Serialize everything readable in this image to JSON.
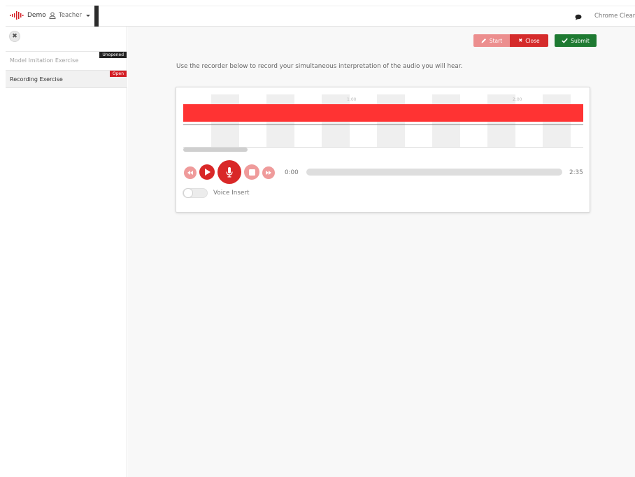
{
  "navbar": {
    "brand_label": "Demo",
    "user_label": "Teacher",
    "browser_label": "Chrome Clean"
  },
  "sidebar": {
    "exercises": [
      {
        "label": "Model Imitation Exercise",
        "badge": "Unopened"
      },
      {
        "label": "Recording Exercise",
        "badge": "Open"
      }
    ]
  },
  "toolbar": {
    "start_label": "Start",
    "close_label": "Close",
    "submit_label": "Submit"
  },
  "main": {
    "instruction": "Use the recorder below to record your simultaneous interpretation of the audio you will hear."
  },
  "recorder": {
    "timeline_ticks": [
      "1:00",
      "2:00"
    ],
    "current_time": "0:00",
    "total_time": "2:35",
    "progress": 0,
    "voice_insert_label": "Voice Insert",
    "voice_insert_on": false
  },
  "colors": {
    "accent_red": "#d92828",
    "waveform_red": "#ff3333",
    "submit_green": "#1e7a32"
  }
}
